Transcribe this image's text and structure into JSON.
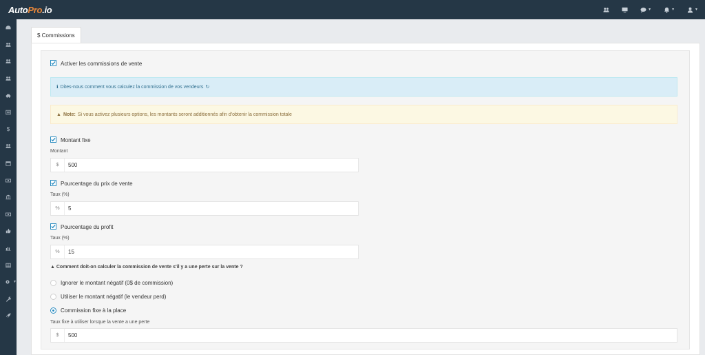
{
  "app": {
    "logo_main": "Auto",
    "logo_accent": "Pro",
    "logo_suffix": ".io"
  },
  "topbar": {
    "icons": [
      "users-icon",
      "monitor-icon",
      "comments-icon",
      "bell-icon",
      "user-icon"
    ]
  },
  "sidebar": {
    "items": [
      "dashboard-icon",
      "users-icon",
      "group-icon",
      "group2-icon",
      "car-icon",
      "list-icon",
      "dollar-icon",
      "team-icon",
      "calendar-icon",
      "money-icon",
      "bank-icon",
      "money2-icon",
      "thumbs-up-icon",
      "chart-icon",
      "grid-icon",
      "gear-icon",
      "wrench-icon",
      "rocket-icon"
    ],
    "dollar_glyph": "$"
  },
  "tabs": [
    {
      "label": "$ Commissions"
    }
  ],
  "form": {
    "enable_label": "Activer les commissions de vente",
    "info_text": "Dites-nous comment vous calculez la commission de vos vendeurs",
    "warn_bold": "Note:",
    "warn_text": "Si vous activez plusieurs options, les montants seront additionnés afin d'obtenir la commission totale",
    "fixed": {
      "label": "Montant fixe",
      "field_label": "Montant",
      "addon": "$",
      "value": "500"
    },
    "price_pct": {
      "label": "Pourcentage du prix de vente",
      "field_label": "Taux (%)",
      "addon": "%",
      "value": "5"
    },
    "profit_pct": {
      "label": "Pourcentage du profit",
      "field_label": "Taux (%)",
      "addon": "%",
      "value": "15"
    },
    "question": "Comment doit-on calculer la commission de vente s'il y a une perte sur la vente ?",
    "options": [
      {
        "label": "Ignorer le montant négatif (0$ de commission)",
        "selected": false
      },
      {
        "label": "Utiliser le montant négatif (le vendeur perd)",
        "selected": false
      },
      {
        "label": "Commission fixe à la place",
        "selected": true
      }
    ],
    "loss_fixed": {
      "field_label": "Taux fixe à utiliser lorsque la vente a une perte",
      "addon": "$",
      "value": "500"
    }
  },
  "colors": {
    "accent": "#2a8cc0",
    "topbar": "#253746",
    "logo_accent": "#e8873a"
  }
}
